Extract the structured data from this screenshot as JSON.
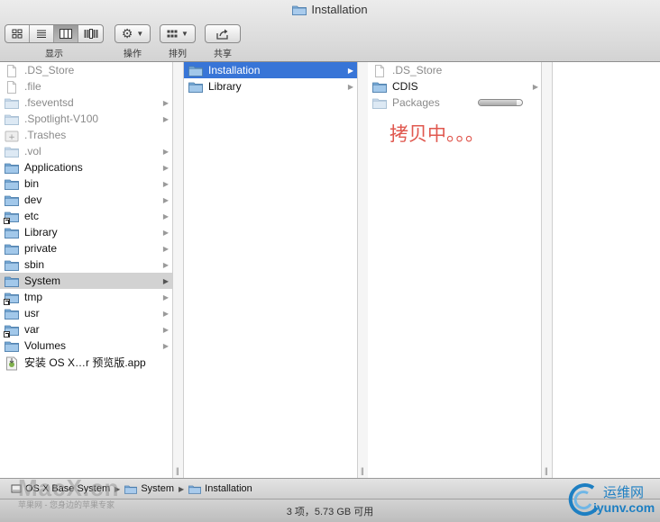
{
  "window": {
    "title": "Installation"
  },
  "toolbar": {
    "view_label": "显示",
    "action_label": "操作",
    "arrange_label": "排列",
    "share_label": "共享"
  },
  "column1": [
    {
      "name": ".DS_Store",
      "kind": "file",
      "hidden": true,
      "arrow": false
    },
    {
      "name": ".file",
      "kind": "file",
      "hidden": true,
      "arrow": false
    },
    {
      "name": ".fseventsd",
      "kind": "folder",
      "hidden": true,
      "arrow": true
    },
    {
      "name": ".Spotlight-V100",
      "kind": "folder",
      "hidden": true,
      "arrow": true
    },
    {
      "name": ".Trashes",
      "kind": "trash",
      "hidden": true,
      "arrow": false
    },
    {
      "name": ".vol",
      "kind": "folder",
      "hidden": true,
      "arrow": true
    },
    {
      "name": "Applications",
      "kind": "folder",
      "hidden": false,
      "arrow": true
    },
    {
      "name": "bin",
      "kind": "folder",
      "hidden": false,
      "arrow": true
    },
    {
      "name": "dev",
      "kind": "folder",
      "hidden": false,
      "arrow": true
    },
    {
      "name": "etc",
      "kind": "alias",
      "hidden": false,
      "arrow": true
    },
    {
      "name": "Library",
      "kind": "folder",
      "hidden": false,
      "arrow": true
    },
    {
      "name": "private",
      "kind": "folder",
      "hidden": false,
      "arrow": true
    },
    {
      "name": "sbin",
      "kind": "folder",
      "hidden": false,
      "arrow": true
    },
    {
      "name": "System",
      "kind": "folder",
      "hidden": false,
      "arrow": true,
      "selected": true
    },
    {
      "name": "tmp",
      "kind": "alias",
      "hidden": false,
      "arrow": true
    },
    {
      "name": "usr",
      "kind": "folder",
      "hidden": false,
      "arrow": true
    },
    {
      "name": "var",
      "kind": "alias",
      "hidden": false,
      "arrow": true
    },
    {
      "name": "Volumes",
      "kind": "folder",
      "hidden": false,
      "arrow": true
    },
    {
      "name": "安装 OS X…r 预览版.app",
      "kind": "app",
      "hidden": false,
      "arrow": false
    }
  ],
  "column2": [
    {
      "name": "Installation",
      "kind": "folder",
      "hidden": false,
      "arrow": true,
      "selected": true
    },
    {
      "name": "Library",
      "kind": "folder",
      "hidden": false,
      "arrow": true
    }
  ],
  "column3": [
    {
      "name": ".DS_Store",
      "kind": "file",
      "hidden": true,
      "arrow": false
    },
    {
      "name": "CDIS",
      "kind": "folder",
      "hidden": false,
      "arrow": true
    },
    {
      "name": "Packages",
      "kind": "folder",
      "hidden": true,
      "arrow": false,
      "progress": 0.88
    }
  ],
  "copying_text": "拷贝中。。。",
  "pathbar": [
    "OS X Base System",
    "System",
    "Installation"
  ],
  "status": "3 项，5.73 GB 可用",
  "watermarks": {
    "left_big": "MacX.cn",
    "left_small": "苹果网 - 您身边的苹果专家",
    "right_top": "运维网",
    "right_bottom": "iyunv.com"
  },
  "colors": {
    "selection_blue": "#3875d7",
    "folder_blue": "#7aaedb",
    "copying_red": "#e0584f"
  }
}
